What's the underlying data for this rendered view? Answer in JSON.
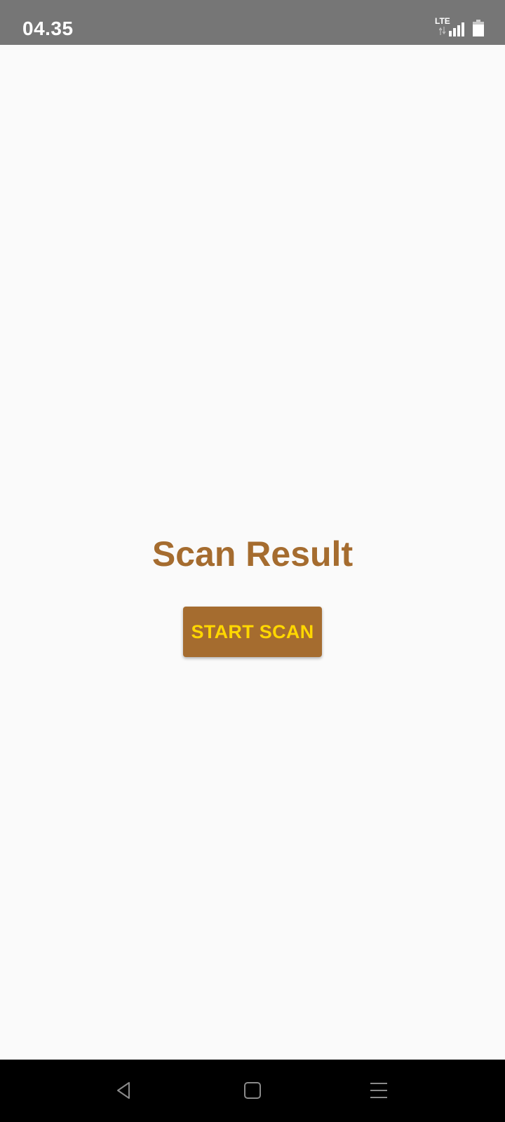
{
  "status_bar": {
    "time": "04.35",
    "network_label": "LTE",
    "icons": [
      "lte-icon",
      "signal-icon",
      "battery-icon"
    ]
  },
  "main": {
    "title": "Scan Result",
    "start_button_label": "START SCAN"
  },
  "nav_bar": {
    "icons": [
      "back-icon",
      "home-icon",
      "menu-icon"
    ]
  },
  "colors": {
    "accent": "#a56c2f",
    "button_text": "#ffd700",
    "status_bar": "#767676",
    "background": "#fafafa",
    "nav_bar": "#000000"
  }
}
